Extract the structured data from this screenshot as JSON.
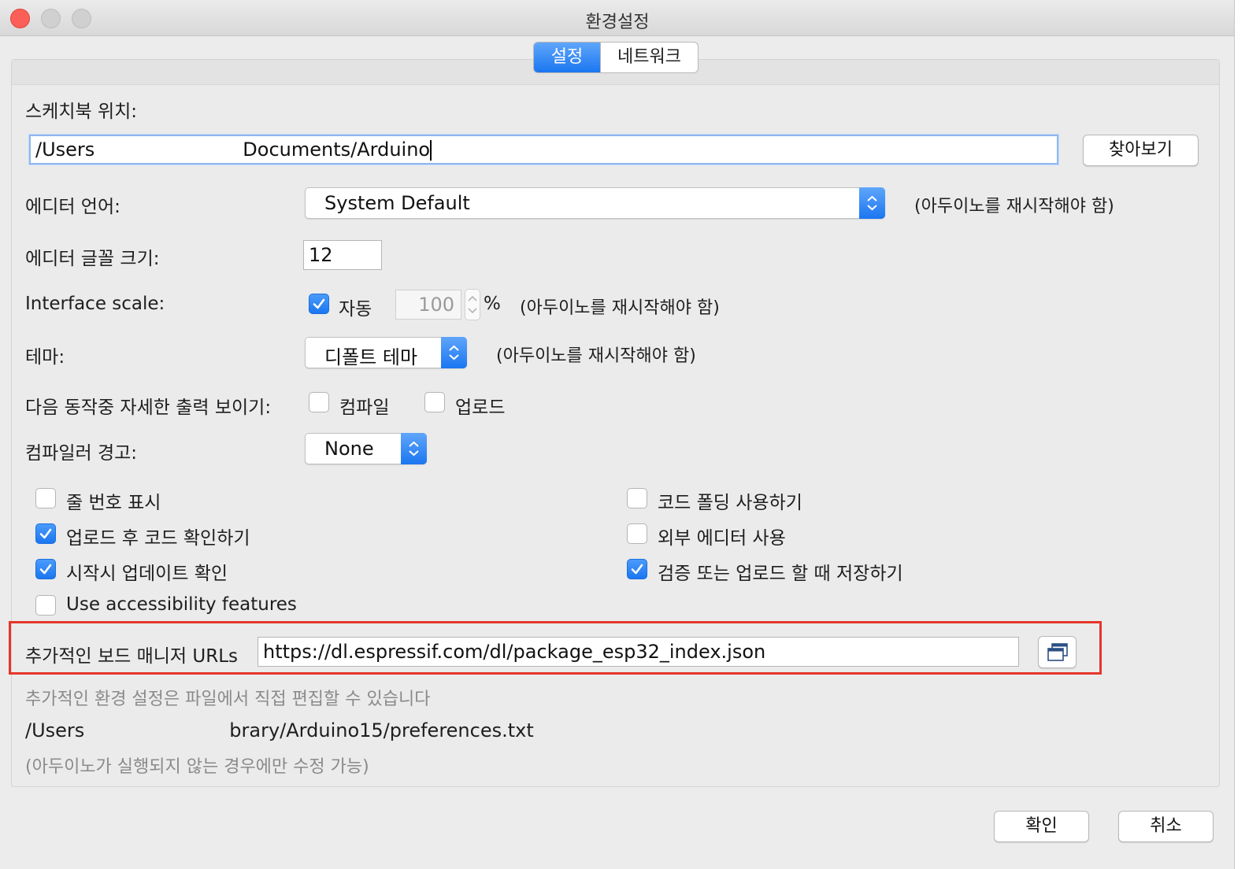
{
  "window": {
    "title": "환경설정"
  },
  "tabs": [
    {
      "label": "설정",
      "active": true
    },
    {
      "label": "네트워크",
      "active": false
    }
  ],
  "sketchbook": {
    "label": "스케치북 위치:",
    "path_prefix": "/Users",
    "path_suffix": "Documents/Arduino",
    "browse_label": "찾아보기"
  },
  "editor_language": {
    "label": "에디터 언어:",
    "value": "System Default",
    "note": "(아두이노를 재시작해야 함)"
  },
  "editor_font": {
    "label": "에디터 글꼴 크기:",
    "value": "12"
  },
  "interface_scale": {
    "label": "Interface scale:",
    "auto_label": "자동",
    "auto_checked": true,
    "value": "100",
    "unit": "%",
    "note": "(아두이노를 재시작해야 함)"
  },
  "theme": {
    "label": "테마:",
    "value": "디폴트 테마",
    "note": "(아두이노를 재시작해야 함)"
  },
  "verbose": {
    "label": "다음 동작중 자세한  출력 보이기:",
    "compile_label": "컴파일",
    "compile_checked": false,
    "upload_label": "업로드",
    "upload_checked": false
  },
  "compiler_warnings": {
    "label": "컴파일러 경고:",
    "value": "None"
  },
  "options_left": [
    {
      "label": "줄 번호 표시",
      "checked": false
    },
    {
      "label": "업로드 후 코드 확인하기",
      "checked": true
    },
    {
      "label": "시작시 업데이트 확인",
      "checked": true
    },
    {
      "label": "Use accessibility features",
      "checked": false
    }
  ],
  "options_right": [
    {
      "label": "코드 폴딩 사용하기",
      "checked": false
    },
    {
      "label": "외부 에디터 사용",
      "checked": false
    },
    {
      "label": "검증 또는 업로드 할 때 저장하기",
      "checked": true
    }
  ],
  "board_urls": {
    "label": "추가적인 보드 매니저 URLs",
    "value": "https://dl.espressif.com/dl/package_esp32_index.json"
  },
  "footer": {
    "more_prefs": "추가적인 환경 설정은 파일에서 직접 편집할 수 있습니다",
    "prefs_path_prefix": "/Users",
    "prefs_path_suffix": "brary/Arduino15/preferences.txt",
    "edit_note": "(아두이노가 실행되지 않는 경우에만 수정 가능)"
  },
  "buttons": {
    "ok": "확인",
    "cancel": "취소"
  },
  "colors": {
    "accent": "#1b76f0",
    "highlight": "#e5362b",
    "close": "#fc5f57"
  }
}
